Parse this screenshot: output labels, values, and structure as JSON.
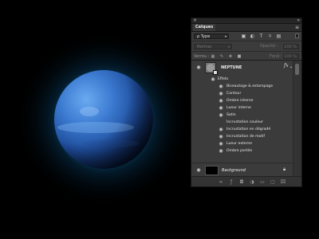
{
  "panel": {
    "close_glyph": "×",
    "collapse_glyph": "»",
    "tab_label": "Calques",
    "menu_glyph": "≡"
  },
  "filter": {
    "label": "Type",
    "prefix_glyph": "ρ",
    "icons": [
      "image-filter-icon",
      "adjustment-filter-icon",
      "text-filter-icon",
      "shape-filter-icon",
      "smart-object-filter-icon"
    ]
  },
  "blend": {
    "mode": "Normal",
    "opacity_label": "Opacité :",
    "opacity_value": "100 %"
  },
  "lock": {
    "label": "Verrou :",
    "fill_label": "Fond :",
    "fill_value": "100 %"
  },
  "layers": {
    "main": {
      "name": "NEPTUNE",
      "fx": "fx"
    },
    "effects_title": "Effets",
    "effects": [
      "Biseautage & estampage",
      "Contour",
      "Ombre interne",
      "Lueur interne",
      "Satin",
      "Incrustation couleur",
      "Incrustation en dégradé",
      "Incrustation de motif",
      "Lueur externe",
      "Ombre portée"
    ],
    "background": {
      "name": "Background"
    }
  },
  "colors": {
    "planet_light": "#5fa0e6",
    "planet_mid": "#2d6cc4",
    "planet_dark": "#0a1f4a",
    "glow": "#0e6ca6",
    "panel_bg": "#3b3b3b"
  }
}
